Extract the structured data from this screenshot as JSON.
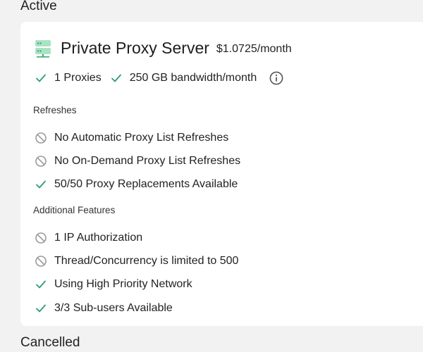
{
  "sections": {
    "active_heading": "Active",
    "cancelled_heading": "Cancelled"
  },
  "plan": {
    "icon": "server-icon",
    "title": "Private Proxy Server",
    "price": "$1.0725/month",
    "summary": [
      {
        "icon": "check-icon",
        "label": "1 Proxies"
      },
      {
        "icon": "check-icon",
        "label": "250 GB bandwidth/month"
      }
    ],
    "info_icon": "info-icon"
  },
  "groups": {
    "refreshes": {
      "label": "Refreshes",
      "items": [
        {
          "status": "unavailable",
          "icon": "blocked-icon",
          "label": "No Automatic Proxy List Refreshes"
        },
        {
          "status": "unavailable",
          "icon": "blocked-icon",
          "label": "No On-Demand Proxy List Refreshes"
        },
        {
          "status": "available",
          "icon": "check-icon",
          "label": "50/50 Proxy Replacements Available"
        }
      ]
    },
    "additional": {
      "label": "Additional Features",
      "items": [
        {
          "status": "unavailable",
          "icon": "blocked-icon",
          "label": "1 IP Authorization"
        },
        {
          "status": "unavailable",
          "icon": "blocked-icon",
          "label": "Thread/Concurrency is limited to 500"
        },
        {
          "status": "available",
          "icon": "check-icon",
          "label": "Using High Priority Network"
        },
        {
          "status": "available",
          "icon": "check-icon",
          "label": "3/3 Sub-users Available"
        }
      ]
    }
  },
  "colors": {
    "check": "#2e9e6e",
    "blocked": "#9a9a9a",
    "server_icon": "#7fd3a8",
    "server_icon_dark": "#3aa873",
    "card_bg": "#ffffff",
    "page_bg": "#f2f2f2"
  }
}
